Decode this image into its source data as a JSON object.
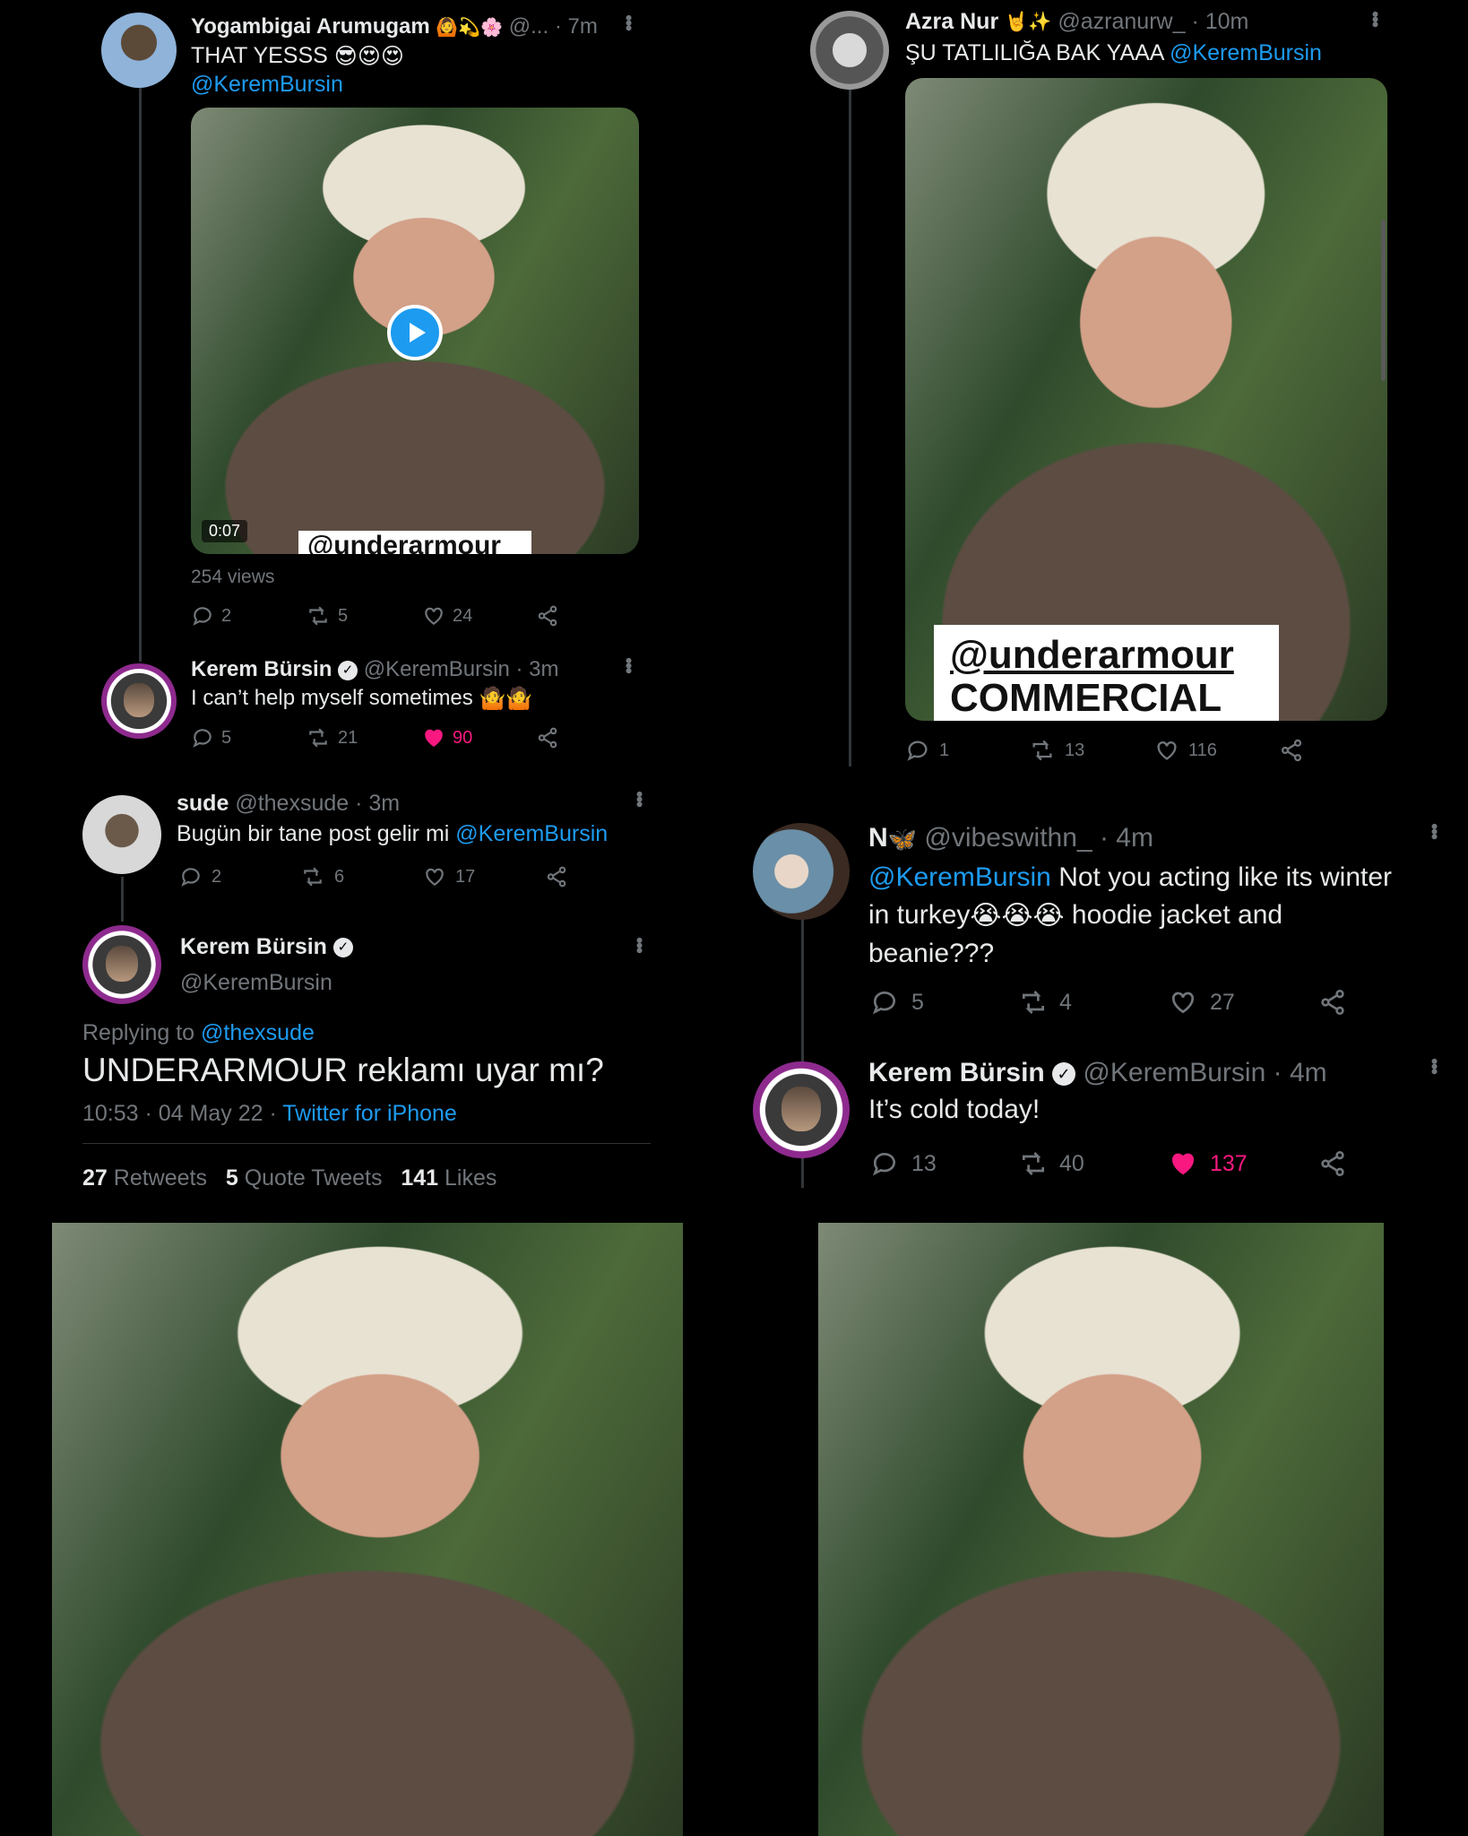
{
  "tweet_a": {
    "name": "Yogambigai Arumugam",
    "handle": "@...",
    "time": "· 7m",
    "text": "THAT YESSS",
    "mention": "@KeremBursin",
    "video_duration": "0:07",
    "video_caption": "@underarmour",
    "views": "254 views",
    "replies": "2",
    "retweets": "5",
    "likes": "24"
  },
  "reply_a": {
    "name": "Kerem Bürsin",
    "handle": "@KeremBursin",
    "time": "· 3m",
    "text": "I can’t help myself sometimes",
    "replies": "5",
    "retweets": "21",
    "likes": "90"
  },
  "tweet_b": {
    "name": "Azra Nur",
    "handle": "@azranurw_",
    "time": "· 10m",
    "text": "ŞU TATLILIĞA BAK YAAA",
    "mention": "@KeremBursin",
    "caption_line1": "@underarmour",
    "caption_line2": "COMMERCIAL",
    "replies": "1",
    "retweets": "13",
    "likes": "116"
  },
  "tweet_c": {
    "name": "sude",
    "handle": "@thexsude",
    "time": "· 3m",
    "text": "Bugün bir tane post gelir mi",
    "mention": "@KeremBursin",
    "replies": "2",
    "retweets": "6",
    "likes": "17"
  },
  "detail": {
    "name": "Kerem Bürsin",
    "handle": "@KeremBursin",
    "replying_label": "Replying to",
    "replying_to": "@thexsude",
    "text": "UNDERARMOUR reklamı uyar mı?",
    "timestamp": "10:53 · 04 May 22 · ",
    "source": "Twitter for iPhone",
    "retweets_count": "27",
    "retweets_label": "Retweets",
    "quotes_count": "5",
    "quotes_label": "Quote Tweets",
    "likes_count": "141",
    "likes_label": "Likes"
  },
  "tweet_d": {
    "name": "N",
    "handle": "@vibeswithn_",
    "time": "· 4m",
    "mention": "@KeremBursin",
    "text1": " Not you acting like its winter",
    "text2": "in turkey",
    "text3": " hoodie jacket and",
    "text4": "beanie???",
    "replies": "5",
    "retweets": "4",
    "likes": "27"
  },
  "reply_d": {
    "name": "Kerem Bürsin",
    "handle": "@KeremBursin",
    "time": "· 4m",
    "text": "It’s cold today!",
    "replies": "13",
    "retweets": "40",
    "likes": "137"
  },
  "colors": {
    "accent": "#1d9bf0",
    "like": "#f91880",
    "muted": "#71767b",
    "text": "#e7e9ea"
  },
  "icons": [
    "reply-icon",
    "retweet-icon",
    "heart-icon",
    "share-icon",
    "verified-icon",
    "play-icon"
  ]
}
